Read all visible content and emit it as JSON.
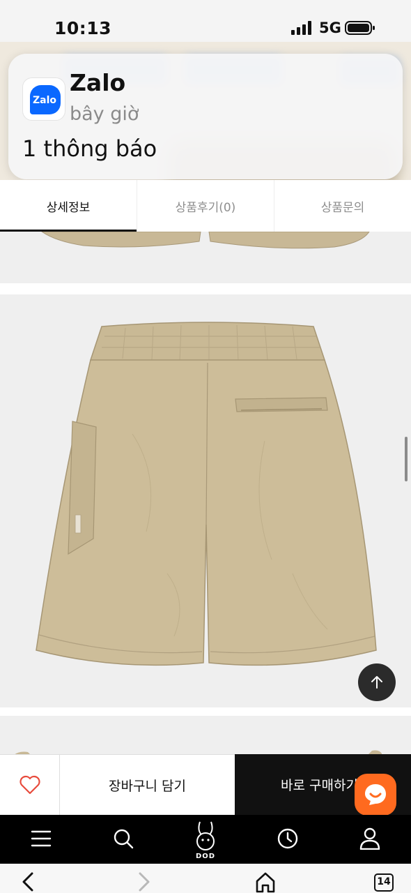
{
  "status_bar": {
    "time": "10:13",
    "network": "5G"
  },
  "notification": {
    "app": "Zalo",
    "logo_text": "Zalo",
    "time": "bây giờ",
    "body": "1 thông báo"
  },
  "tabs": [
    {
      "label": "상세정보",
      "active": true
    },
    {
      "label": "상품후기(0)",
      "active": false
    },
    {
      "label": "상품문의",
      "active": false
    }
  ],
  "purchase": {
    "cart_label": "장바구니 담기",
    "buy_label": "바로 구매하기"
  },
  "bottom_nav": {
    "brand": "DOD",
    "items": [
      "menu-icon",
      "search-icon",
      "brand-logo",
      "history-icon",
      "user-icon"
    ]
  },
  "browser": {
    "tab_count": "14"
  },
  "colors": {
    "accent": "#ff6a1f",
    "product": "#c8b896",
    "dark": "#111111",
    "zalo": "#0a68ff"
  }
}
